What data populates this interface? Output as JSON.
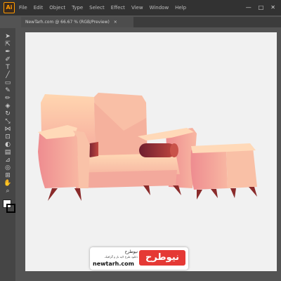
{
  "app": {
    "logo_text": "Ai"
  },
  "menu": [
    "File",
    "Edit",
    "Object",
    "Type",
    "Select",
    "Effect",
    "View",
    "Window",
    "Help"
  ],
  "window_controls": {
    "minimize": "—",
    "maximize": "□",
    "close": "✕"
  },
  "document_tab": {
    "title": "NewTarh.com @ 66.67 % (RGB/Preview)",
    "close": "×"
  },
  "tools": [
    {
      "name": "selection-tool-icon",
      "glyph": "➤"
    },
    {
      "name": "direct-selection-tool-icon",
      "glyph": "⇱"
    },
    {
      "name": "pen-tool-icon",
      "glyph": "✒"
    },
    {
      "name": "curvature-tool-icon",
      "glyph": "✐"
    },
    {
      "name": "type-tool-icon",
      "glyph": "T"
    },
    {
      "name": "line-tool-icon",
      "glyph": "╱"
    },
    {
      "name": "rectangle-tool-icon",
      "glyph": "▭"
    },
    {
      "name": "paintbrush-tool-icon",
      "glyph": "✎"
    },
    {
      "name": "pencil-tool-icon",
      "glyph": "✏"
    },
    {
      "name": "eraser-tool-icon",
      "glyph": "◈"
    },
    {
      "name": "rotate-tool-icon",
      "glyph": "↻"
    },
    {
      "name": "scale-tool-icon",
      "glyph": "⤡"
    },
    {
      "name": "width-tool-icon",
      "glyph": "⋈"
    },
    {
      "name": "free-transform-tool-icon",
      "glyph": "⊡"
    },
    {
      "name": "shape-builder-tool-icon",
      "glyph": "◐"
    },
    {
      "name": "gradient-tool-icon",
      "glyph": "▤"
    },
    {
      "name": "eyedropper-tool-icon",
      "glyph": "⊿"
    },
    {
      "name": "blend-tool-icon",
      "glyph": "◎"
    },
    {
      "name": "artboard-tool-icon",
      "glyph": "⊞"
    },
    {
      "name": "hand-tool-icon",
      "glyph": "✋"
    },
    {
      "name": "zoom-tool-icon",
      "glyph": "⌕"
    }
  ],
  "colors": {
    "app_bg": "#535353",
    "artboard": "#f1f1f1",
    "sofa_light": "#ffd1a8",
    "sofa_mid": "#f6a99c",
    "sofa_dark": "#e9858a",
    "pillow": "#a0303e",
    "legs": "#8a2b2b",
    "watermark_accent": "#e53935"
  },
  "watermark": {
    "brand": "نیوطرح",
    "name": "نیوطرح",
    "tagline": "دانلود طرح لایه باز و گرافیک",
    "domain": "newtarh.com"
  }
}
